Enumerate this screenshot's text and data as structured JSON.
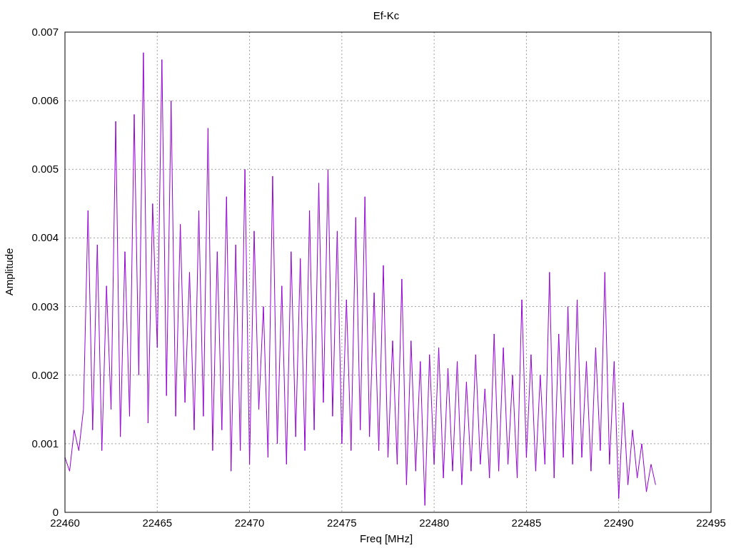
{
  "chart": {
    "chart_data": {
      "type": "line",
      "title": "Ef-Kc",
      "xlabel": "Freq [MHz]",
      "ylabel": "Amplitude",
      "grid": true,
      "xlim": [
        22460,
        22495
      ],
      "ylim": [
        0,
        0.007
      ],
      "xticks": [
        {
          "value": 22460,
          "label": "22460"
        },
        {
          "value": 22465,
          "label": "22465"
        },
        {
          "value": 22470,
          "label": "22470"
        },
        {
          "value": 22475,
          "label": "22475"
        },
        {
          "value": 22480,
          "label": "22480"
        },
        {
          "value": 22485,
          "label": "22485"
        },
        {
          "value": 22490,
          "label": "22490"
        },
        {
          "value": 22495,
          "label": "22495"
        }
      ],
      "yticks": [
        {
          "value": 0,
          "label": "0"
        },
        {
          "value": 0.001,
          "label": "0.001"
        },
        {
          "value": 0.002,
          "label": "0.002"
        },
        {
          "value": 0.003,
          "label": "0.003"
        },
        {
          "value": 0.004,
          "label": "0.004"
        },
        {
          "value": 0.005,
          "label": "0.005"
        },
        {
          "value": 0.006,
          "label": "0.006"
        },
        {
          "value": 0.007,
          "label": "0.007"
        }
      ],
      "x": [
        22460,
        22460.25,
        22460.5,
        22460.75,
        22461,
        22461.25,
        22461.5,
        22461.75,
        22462,
        22462.25,
        22462.5,
        22462.75,
        22463,
        22463.25,
        22463.5,
        22463.75,
        22464,
        22464.25,
        22464.5,
        22464.75,
        22465,
        22465.25,
        22465.5,
        22465.75,
        22466,
        22466.25,
        22466.5,
        22466.75,
        22467,
        22467.25,
        22467.5,
        22467.75,
        22468,
        22468.25,
        22468.5,
        22468.75,
        22469,
        22469.25,
        22469.5,
        22469.75,
        22470,
        22470.25,
        22470.5,
        22470.75,
        22471,
        22471.25,
        22471.5,
        22471.75,
        22472,
        22472.25,
        22472.5,
        22472.75,
        22473,
        22473.25,
        22473.5,
        22473.75,
        22474,
        22474.25,
        22474.5,
        22474.75,
        22475,
        22475.25,
        22475.5,
        22475.75,
        22476,
        22476.25,
        22476.5,
        22476.75,
        22477,
        22477.25,
        22477.5,
        22477.75,
        22478,
        22478.25,
        22478.5,
        22478.75,
        22479,
        22479.25,
        22479.5,
        22479.75,
        22480,
        22480.25,
        22480.5,
        22480.75,
        22481,
        22481.25,
        22481.5,
        22481.75,
        22482,
        22482.25,
        22482.5,
        22482.75,
        22483,
        22483.25,
        22483.5,
        22483.75,
        22484,
        22484.25,
        22484.5,
        22484.75,
        22485,
        22485.25,
        22485.5,
        22485.75,
        22486,
        22486.25,
        22486.5,
        22486.75,
        22487,
        22487.25,
        22487.5,
        22487.75,
        22488,
        22488.25,
        22488.5,
        22488.75,
        22489,
        22489.25,
        22489.5,
        22489.75,
        22490,
        22490.25,
        22490.5,
        22490.75,
        22491,
        22491.25,
        22491.5,
        22491.75,
        22492
      ],
      "series": [
        {
          "color": "#9400d3",
          "values": [
            0.0008,
            0.0006,
            0.0012,
            0.0009,
            0.0015,
            0.0044,
            0.0012,
            0.0039,
            0.0009,
            0.0033,
            0.0015,
            0.0057,
            0.0011,
            0.0038,
            0.0014,
            0.0058,
            0.002,
            0.0067,
            0.0013,
            0.0045,
            0.0024,
            0.0066,
            0.0017,
            0.006,
            0.0014,
            0.0042,
            0.0016,
            0.0035,
            0.0012,
            0.0044,
            0.0014,
            0.0056,
            0.0009,
            0.0038,
            0.0012,
            0.0046,
            0.0006,
            0.0039,
            0.0009,
            0.005,
            0.0007,
            0.0041,
            0.0015,
            0.003,
            0.0008,
            0.0049,
            0.001,
            0.0033,
            0.0007,
            0.0038,
            0.0011,
            0.0037,
            0.0009,
            0.0044,
            0.0012,
            0.0048,
            0.0016,
            0.005,
            0.0014,
            0.0041,
            0.001,
            0.0031,
            0.0009,
            0.0043,
            0.0012,
            0.0046,
            0.0011,
            0.0032,
            0.0009,
            0.0036,
            0.0008,
            0.0025,
            0.0007,
            0.0034,
            0.0004,
            0.0025,
            0.0006,
            0.0022,
            0.0001,
            0.0023,
            0.0007,
            0.0024,
            0.0005,
            0.0021,
            0.0006,
            0.0022,
            0.0004,
            0.0019,
            0.0006,
            0.0023,
            0.0007,
            0.0018,
            0.0005,
            0.0026,
            0.0006,
            0.0024,
            0.0007,
            0.002,
            0.0005,
            0.0031,
            0.0008,
            0.0023,
            0.0006,
            0.002,
            0.0007,
            0.0035,
            0.0005,
            0.0026,
            0.0008,
            0.003,
            0.0007,
            0.0031,
            0.0008,
            0.0022,
            0.0006,
            0.0024,
            0.0009,
            0.0035,
            0.0007,
            0.0022,
            0.0002,
            0.0016,
            0.0004,
            0.0012,
            0.0005,
            0.001,
            0.0003,
            0.0007,
            0.0004
          ]
        }
      ]
    }
  }
}
